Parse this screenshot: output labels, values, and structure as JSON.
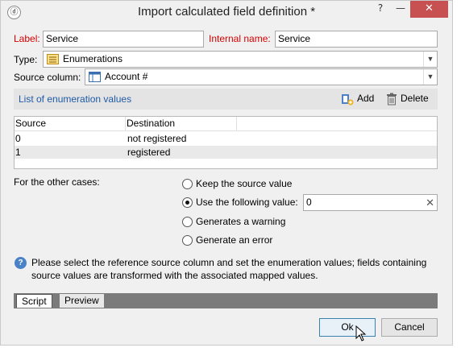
{
  "window": {
    "title": "Import calculated field definition *",
    "help_glyph": "?",
    "minimize_glyph": "—",
    "close_glyph": "✕"
  },
  "form": {
    "label_caption": "Label:",
    "label_value": "Service",
    "internal_name_caption": "Internal name:",
    "internal_name_value": "Service",
    "type_caption": "Type:",
    "type_value": "Enumerations",
    "source_column_caption": "Source column:",
    "source_column_value": "Account #"
  },
  "enum_list": {
    "title": "List of enumeration values",
    "add_label": "Add",
    "delete_label": "Delete",
    "columns": [
      "Source",
      "Destination"
    ],
    "rows": [
      {
        "source": "0",
        "destination": "not registered"
      },
      {
        "source": "1",
        "destination": "registered"
      }
    ]
  },
  "other_cases": {
    "caption": "For the other cases:",
    "options": [
      {
        "label": "Keep the source value",
        "selected": false
      },
      {
        "label": "Use the following value:",
        "selected": true
      },
      {
        "label": "Generates a warning",
        "selected": false
      },
      {
        "label": "Generate an error",
        "selected": false
      }
    ],
    "value": "0"
  },
  "help": {
    "text": "Please select the reference source column and set the enumeration values; fields containing source values are transformed with the associated mapped values."
  },
  "tabs": [
    "Script",
    "Preview"
  ],
  "buttons": {
    "ok": "Ok",
    "cancel": "Cancel"
  },
  "colors": {
    "required_label": "#d40000",
    "link": "#1f5aa6",
    "close_button": "#c75050"
  }
}
